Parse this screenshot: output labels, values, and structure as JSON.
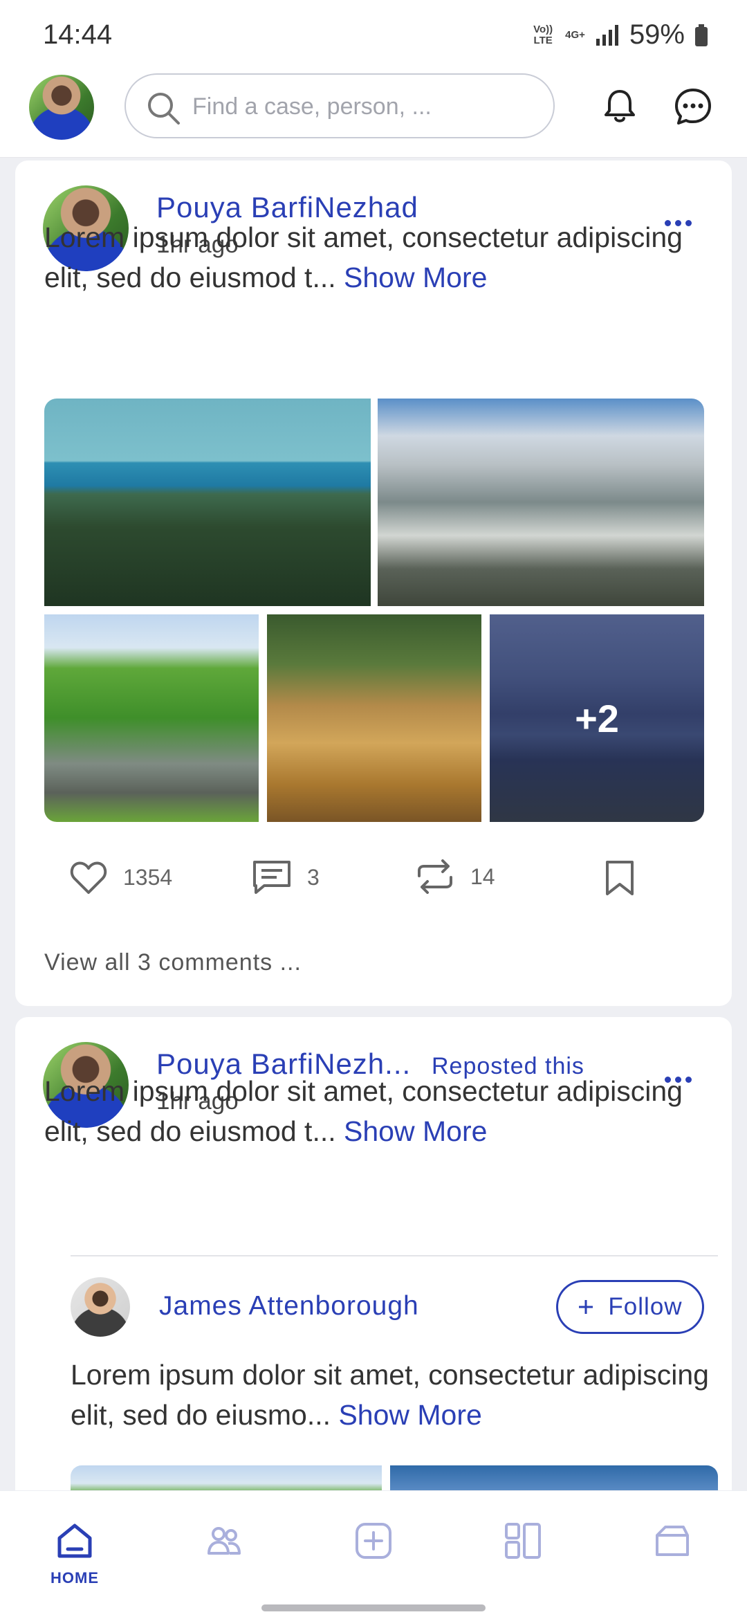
{
  "status_bar": {
    "time": "14:44",
    "volte_label": "Vo)) LTE",
    "network_label": "4G+",
    "battery": "59%"
  },
  "header": {
    "search_placeholder": "Find a case, person, ..."
  },
  "posts": [
    {
      "author": "Pouya BarfiNezhad",
      "time": "1hr ago",
      "text": "Lorem ipsum dolor sit amet, consectetur adipiscing elit, sed do eiusmod t...",
      "show_more": "Show More",
      "gallery_more_count": "+2",
      "likes": "1354",
      "comments": "3",
      "reposts": "14",
      "view_comments": "View all 3 comments ..."
    },
    {
      "author": "Pouya BarfiNezh...",
      "repost_label": "Reposted this",
      "time": "1hr ago",
      "text": "Lorem ipsum dolor sit amet, consectetur adipiscing elit, sed do eiusmod t...",
      "show_more": "Show More",
      "inner": {
        "author": "James Attenborough",
        "follow_label": "Follow",
        "text": "Lorem ipsum dolor sit amet, consectetur adipiscing elit, sed do eiusmo...",
        "show_more": "Show More"
      }
    }
  ],
  "bottom_nav": {
    "home_label": "HOME",
    "active_color": "#2a3fb5",
    "inactive_color": "#a9afdc"
  },
  "icons": [
    "search-icon",
    "bell-icon",
    "chat-icon",
    "more-icon",
    "heart-icon",
    "comment-icon",
    "repost-icon",
    "bookmark-icon",
    "plus-icon",
    "home-icon",
    "people-icon",
    "add-icon",
    "dashboard-icon",
    "folder-icon"
  ]
}
